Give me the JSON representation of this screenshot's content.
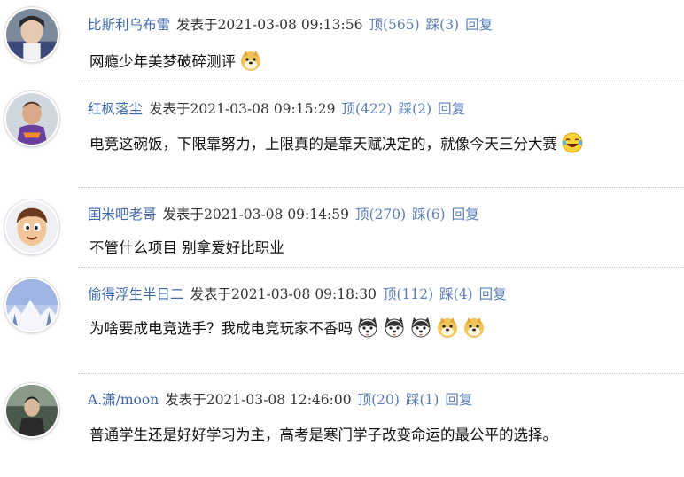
{
  "comments": [
    {
      "user": "比斯利乌布雷",
      "posted_prefix": "发表于",
      "timestamp": "2021-03-08 09:13:56",
      "up_label": "顶(565)",
      "down_label": "踩(3)",
      "reply_label": "回复",
      "text": "网瘾少年美梦破碎测评",
      "emoticons": [
        "doge-emoji"
      ]
    },
    {
      "user": "红枫落尘",
      "posted_prefix": "发表于",
      "timestamp": "2021-03-08 09:15:29",
      "up_label": "顶(422)",
      "down_label": "踩(2)",
      "reply_label": "回复",
      "text": "电竞这碗饭，下限靠努力，上限真的是靠天赋决定的，就像今天三分大赛",
      "emoticons": [
        "laughing-tears-emoji"
      ]
    },
    {
      "user": "国米吧老哥",
      "posted_prefix": "发表于",
      "timestamp": "2021-03-08 09:14:59",
      "up_label": "顶(270)",
      "down_label": "踩(6)",
      "reply_label": "回复",
      "text": "不管什么项目 别拿爱好比职业",
      "emoticons": []
    },
    {
      "user": "偷得浮生半日二",
      "posted_prefix": "发表于",
      "timestamp": "2021-03-08 09:18:30",
      "up_label": "顶(112)",
      "down_label": "踩(4)",
      "reply_label": "回复",
      "text": "为啥要成电竞选手？我成电竞玩家不香吗",
      "emoticons": [
        "husky-emoji",
        "husky-emoji",
        "husky-emoji",
        "doge-emoji",
        "doge-emoji"
      ]
    },
    {
      "user": "A.潇/moon",
      "posted_prefix": "发表于",
      "timestamp": "2021-03-08 12:46:00",
      "up_label": "顶(20)",
      "down_label": "踩(1)",
      "reply_label": "回复",
      "text": "普通学生还是好好学习为主，高考是寒门学子改变命运的最公平的选择。",
      "emoticons": []
    }
  ],
  "colors": {
    "username": "#3f6aa8",
    "action": "#5a7fb8",
    "text": "#111111"
  }
}
